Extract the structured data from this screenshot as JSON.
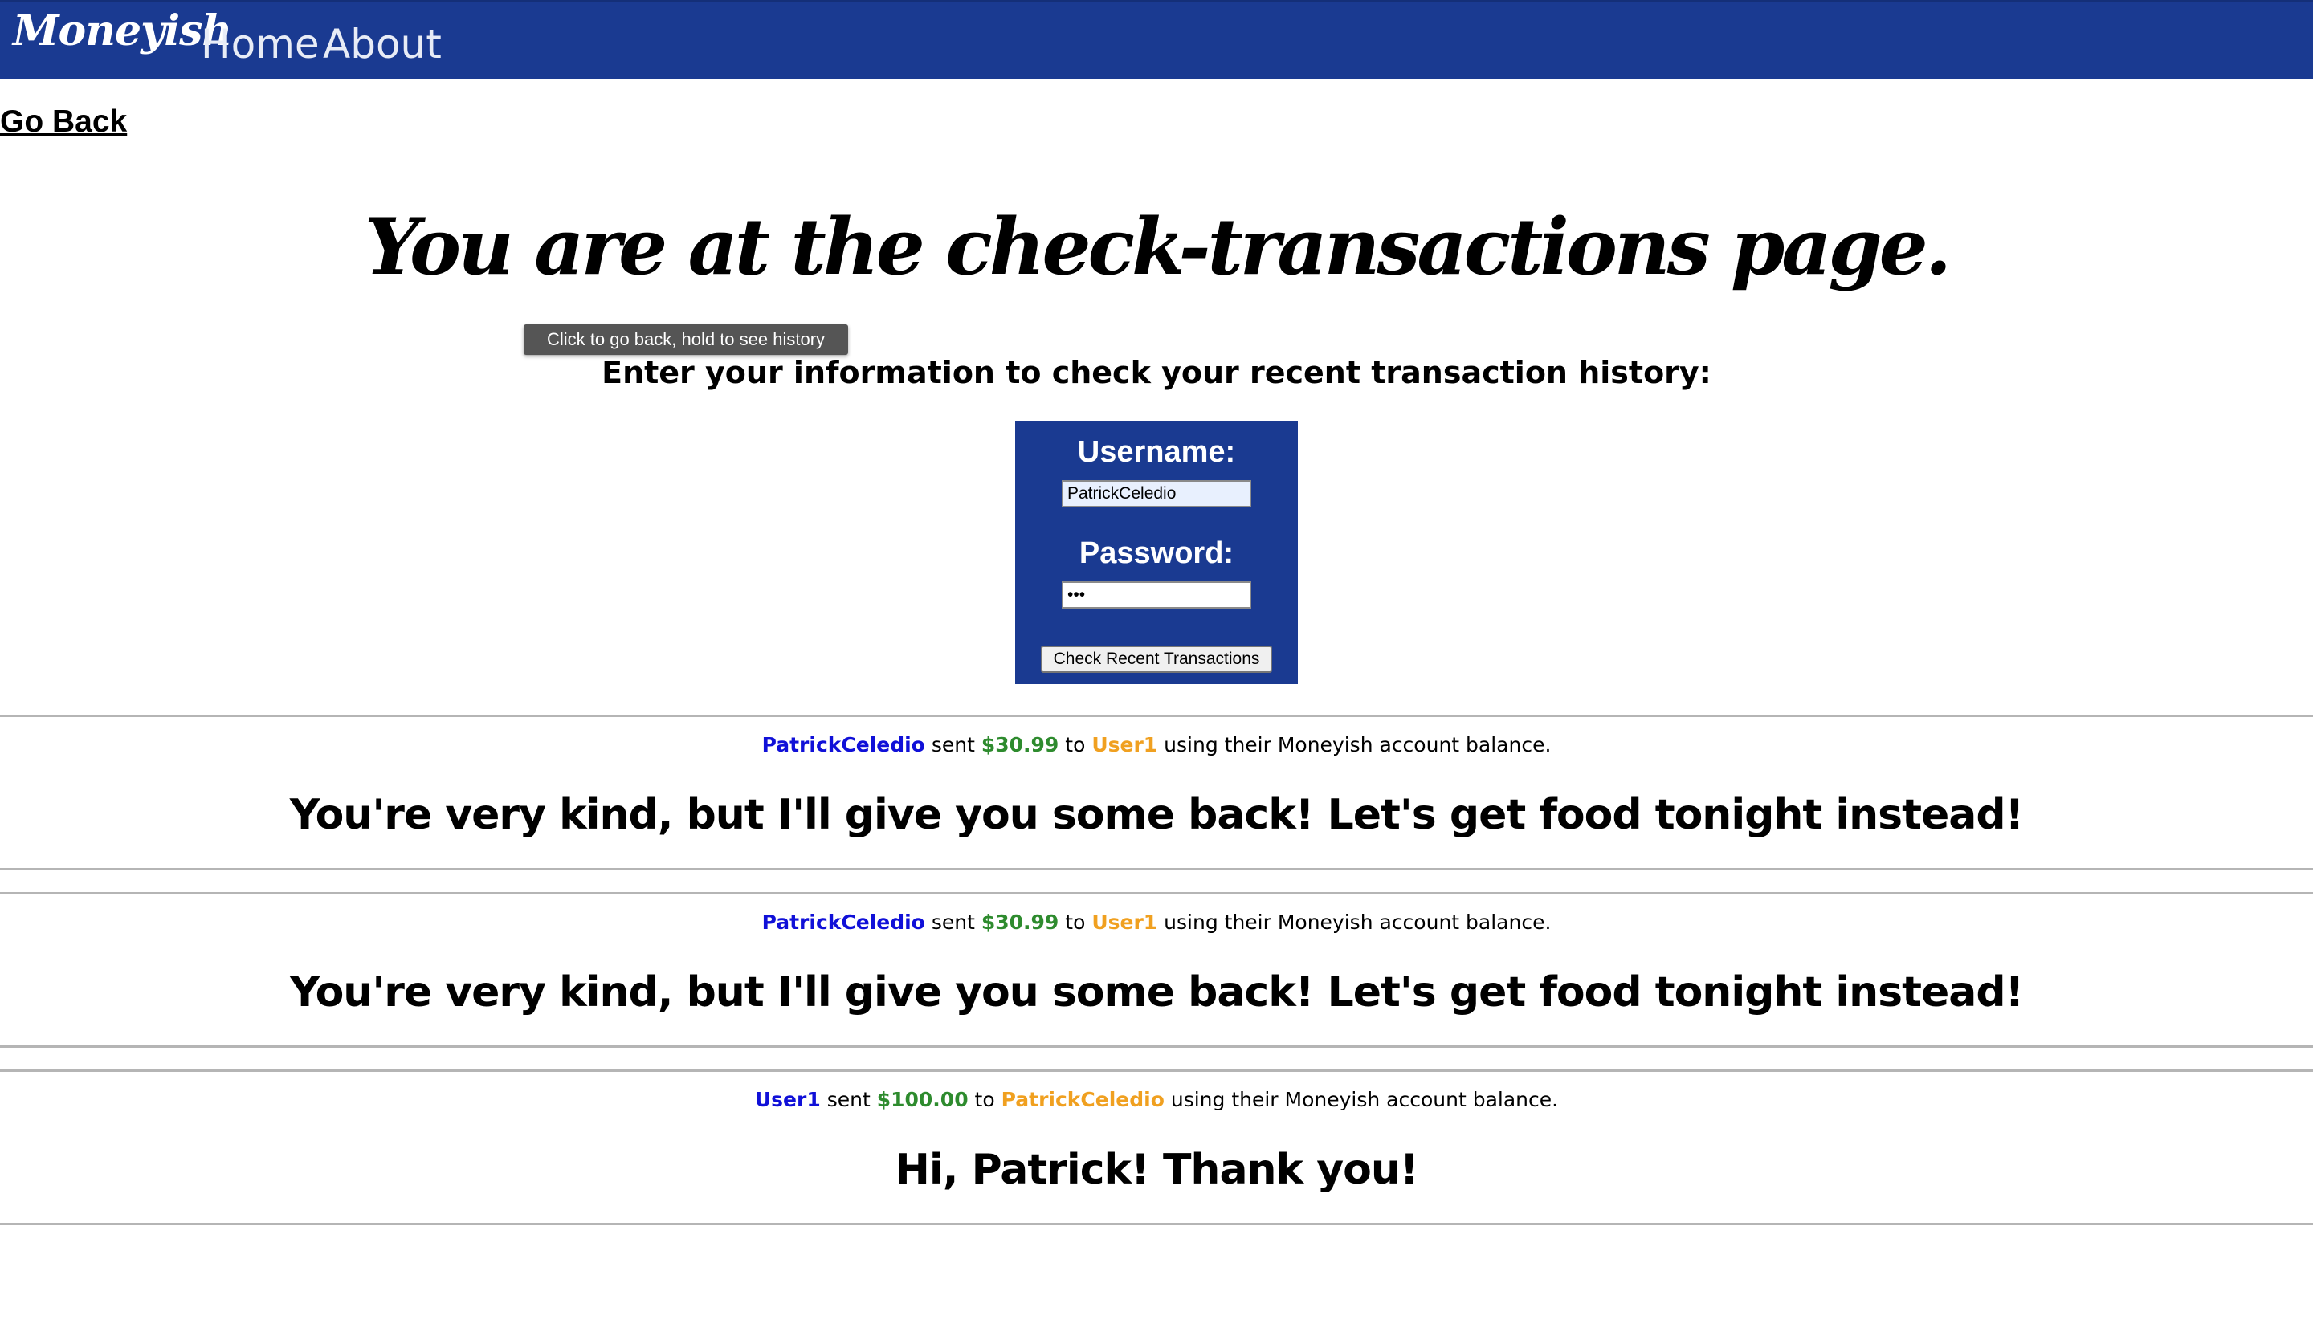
{
  "navbar": {
    "brand": "Moneyish",
    "links": [
      "Home",
      "About"
    ]
  },
  "go_back_label": "Go Back",
  "heading": "You are at the check-transactions page.",
  "tooltip": "Click to go back, hold to see history",
  "subheading": "Enter your information to check your recent transaction history:",
  "form": {
    "username_label": "Username:",
    "username_value": "PatrickCeledio",
    "password_label": "Password:",
    "password_value": "•••",
    "submit_label": "Check Recent Transactions"
  },
  "transactions": [
    {
      "sender": "PatrickCeledio",
      "sent": "sent",
      "amount": "$30.99",
      "to": "to",
      "receiver": "User1",
      "suffix": "using their Moneyish account balance.",
      "message": "You're very kind, but I'll give you some back! Let's get food tonight instead!"
    },
    {
      "sender": "PatrickCeledio",
      "sent": "sent",
      "amount": "$30.99",
      "to": "to",
      "receiver": "User1",
      "suffix": "using their Moneyish account balance.",
      "message": "You're very kind, but I'll give you some back! Let's get food tonight instead!"
    },
    {
      "sender": "User1",
      "sent": "sent",
      "amount": "$100.00",
      "to": "to",
      "receiver": "PatrickCeledio",
      "suffix": "using their Moneyish account balance.",
      "message": "Hi, Patrick! Thank you!"
    }
  ],
  "colors": {
    "navbar": "#1a3a91",
    "sender": "#1010d8",
    "amount": "#2e8b2e",
    "receiver": "#f0a020"
  }
}
